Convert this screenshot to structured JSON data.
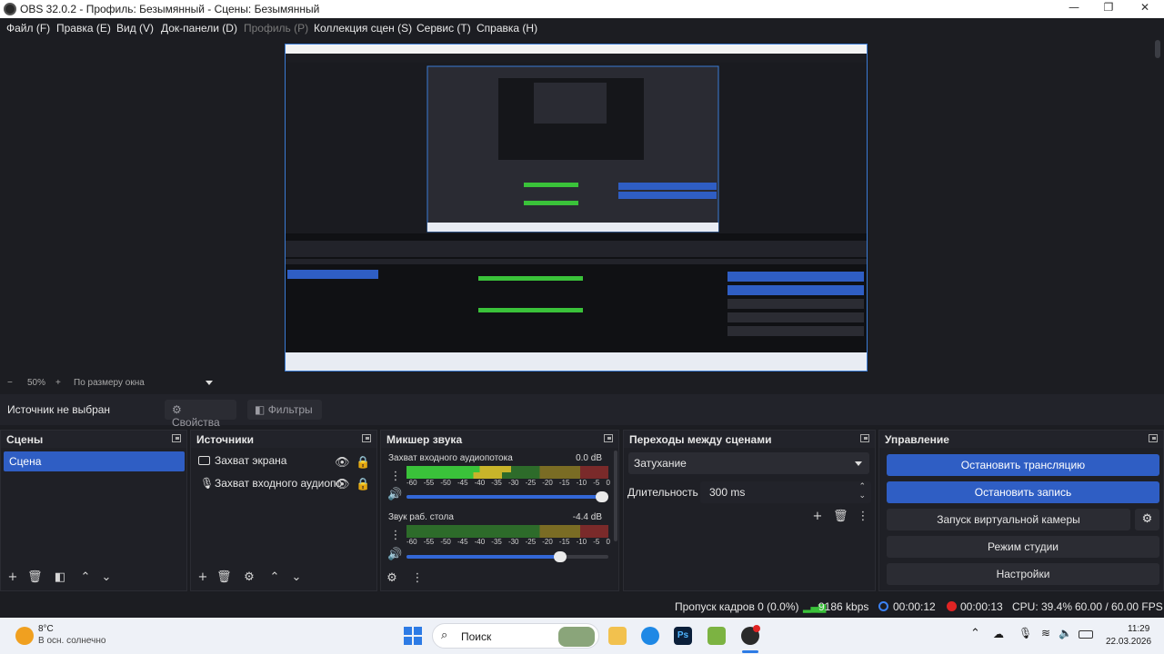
{
  "window": {
    "title": "OBS 32.0.2 - Профиль: Безымянный - Сцены: Безымянный",
    "controls": [
      "—",
      "❐",
      "✕"
    ]
  },
  "menu": [
    {
      "label": "Файл (F)",
      "disabled": false
    },
    {
      "label": "Правка (E)",
      "disabled": false
    },
    {
      "label": "Вид (V)",
      "disabled": false
    },
    {
      "label": "Док-панели (D)",
      "disabled": false
    },
    {
      "label": "Профиль (P)",
      "disabled": true
    },
    {
      "label": "Коллекция сцен (S)",
      "disabled": false
    },
    {
      "label": "Сервис (T)",
      "disabled": false
    },
    {
      "label": "Справка (H)",
      "disabled": false
    }
  ],
  "zoom": {
    "minus": "−",
    "value": "50%",
    "plus": "+",
    "fit": "По размеру окна"
  },
  "source_toolbar": {
    "no_source": "Источник не выбран",
    "properties": "Свойства",
    "filters": "Фильтры"
  },
  "scenes": {
    "title": "Сцены",
    "items": [
      {
        "label": "Сцена",
        "selected": true
      }
    ]
  },
  "sources": {
    "title": "Источники",
    "items": [
      {
        "label": "Захват экрана",
        "icon": "monitor-icon"
      },
      {
        "label": "Захват входного аудиопотока",
        "icon": "microphone-icon"
      }
    ]
  },
  "mixer": {
    "title": "Микшер звука",
    "scale": [
      "-60",
      "-55",
      "-50",
      "-45",
      "-40",
      "-35",
      "-30",
      "-25",
      "-20",
      "-15",
      "-10",
      "-5",
      "0"
    ],
    "channels": [
      {
        "name": "Захват входного аудиопотока",
        "db": "0.0 dB",
        "level": 0.52,
        "volume": 1.0
      },
      {
        "name": "Звук раб. стола",
        "db": "-4.4 dB",
        "level": 0.0,
        "volume": 0.78
      }
    ]
  },
  "transitions": {
    "title": "Переходы между сценами",
    "selected": "Затухание",
    "duration_label": "Длительность",
    "duration_value": "300 ms"
  },
  "controls": {
    "title": "Управление",
    "buttons": [
      {
        "label": "Остановить трансляцию",
        "active": true
      },
      {
        "label": "Остановить запись",
        "active": true
      },
      {
        "label": "Запуск виртуальной камеры",
        "active": false
      },
      {
        "label": "Режим студии",
        "active": false
      },
      {
        "label": "Настройки",
        "active": false
      }
    ]
  },
  "status": {
    "dropped_frames": "Пропуск кадров 0 (0.0%)",
    "bitrate": "9186 kbps",
    "stream_time": "00:00:12",
    "record_time": "00:00:13",
    "cpu": "CPU: 39.4%",
    "fps": "60.00 / 60.00 FPS"
  },
  "taskbar": {
    "weather_temp": "8°C",
    "weather_desc": "В осн. солнечно",
    "search": "Поиск",
    "time": "11:29",
    "date": "22.03.2026"
  },
  "colors": {
    "accent": "#2f5ec4",
    "background": "#1c1d22",
    "panel": "#1f2026",
    "record": "#e02424",
    "stream": "#3b82f6",
    "bitrate": "#3ac23a"
  }
}
